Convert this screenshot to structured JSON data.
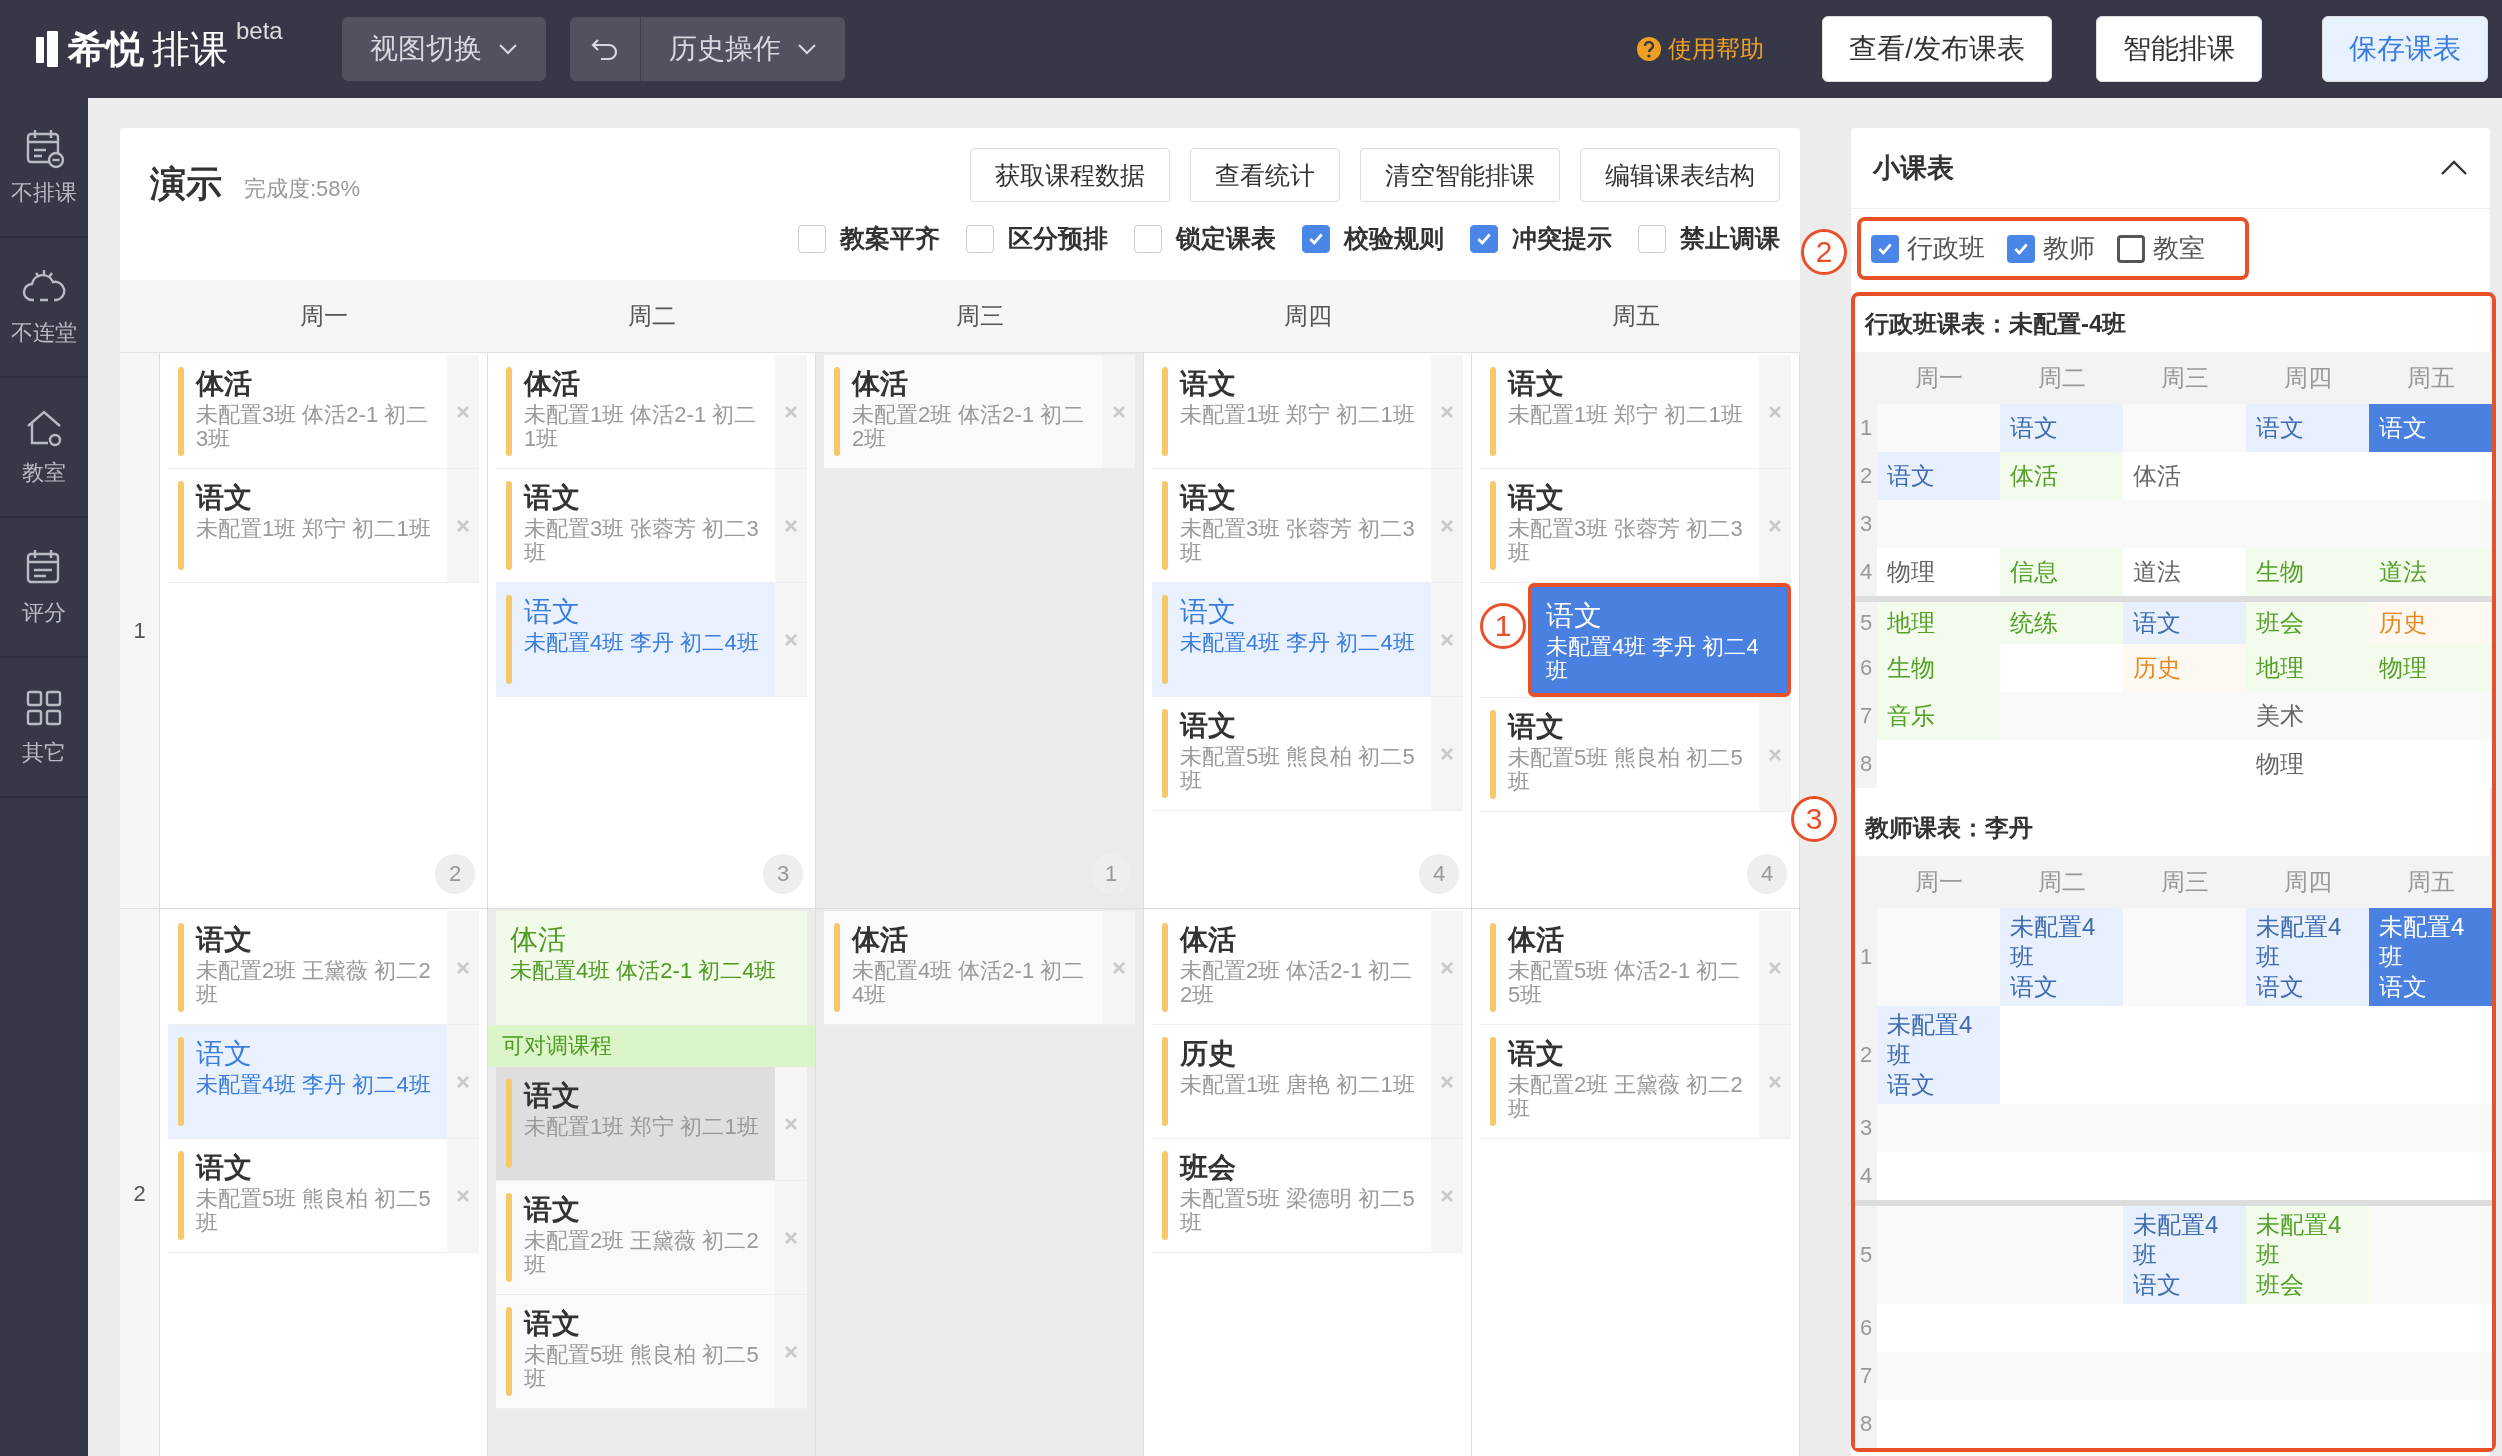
{
  "app": {
    "brand": "希悦",
    "product": "排课",
    "tag": "beta"
  },
  "toolbar": {
    "view_menu": "视图切换",
    "history_menu": "历史操作",
    "help": "使用帮助",
    "buttons": [
      {
        "label": "查看/发布课表",
        "kind": "default"
      },
      {
        "label": "智能排课",
        "kind": "default"
      },
      {
        "label": "保存课表",
        "kind": "primary"
      }
    ]
  },
  "sidebar": [
    {
      "label": "不排课",
      "kind": "calendar"
    },
    {
      "label": "不连堂",
      "kind": "link"
    },
    {
      "label": "教室",
      "kind": "house"
    },
    {
      "label": "评分",
      "kind": "list"
    },
    {
      "label": "其它",
      "kind": "grid"
    }
  ],
  "schedule": {
    "title": "演示",
    "progress": "完成度:58%",
    "actions": [
      "获取课程数据",
      "查看统计",
      "清空智能排课",
      "编辑课表结构"
    ],
    "options": [
      {
        "label": "教案平齐",
        "checked": false
      },
      {
        "label": "区分预排",
        "checked": false
      },
      {
        "label": "锁定课表",
        "checked": false
      },
      {
        "label": "校验规则",
        "checked": true
      },
      {
        "label": "冲突提示",
        "checked": true
      },
      {
        "label": "禁止调课",
        "checked": false
      }
    ],
    "days": [
      "周一",
      "周二",
      "周三",
      "周四",
      "周五"
    ],
    "periods": [
      {
        "label": "1",
        "cells": [
          {
            "shaded": false,
            "count": "2",
            "items": [
              {
                "kind": "normal",
                "selected": false,
                "subject": "体活",
                "info": "未配置3班 体活2-1 初二3班"
              },
              {
                "kind": "normal",
                "selected": false,
                "subject": "语文",
                "info": "未配置1班 郑宁 初二1班"
              }
            ]
          },
          {
            "shaded": false,
            "count": "3",
            "items": [
              {
                "kind": "normal",
                "selected": false,
                "subject": "体活",
                "info": "未配置1班 体活2-1 初二1班"
              },
              {
                "kind": "normal",
                "selected": false,
                "subject": "语文",
                "info": "未配置3班 张蓉芳 初二3班"
              },
              {
                "kind": "related",
                "selected": false,
                "subject": "语文",
                "info": "未配置4班 李丹 初二4班"
              }
            ]
          },
          {
            "shaded": true,
            "count": "1",
            "items": [
              {
                "kind": "normal",
                "selected": false,
                "subject": "体活",
                "info": "未配置2班 体活2-1 初二2班"
              }
            ]
          },
          {
            "shaded": false,
            "count": "4",
            "items": [
              {
                "kind": "normal",
                "selected": false,
                "subject": "语文",
                "info": "未配置1班 郑宁 初二1班"
              },
              {
                "kind": "normal",
                "selected": false,
                "subject": "语文",
                "info": "未配置3班 张蓉芳 初二3班"
              },
              {
                "kind": "related",
                "selected": false,
                "subject": "语文",
                "info": "未配置4班 李丹 初二4班"
              },
              {
                "kind": "normal",
                "selected": false,
                "subject": "语文",
                "info": "未配置5班 熊良柏 初二5班"
              }
            ]
          },
          {
            "shaded": false,
            "count": "4",
            "items": [
              {
                "kind": "normal",
                "selected": false,
                "subject": "语文",
                "info": "未配置1班 郑宁 初二1班"
              },
              {
                "kind": "normal",
                "selected": false,
                "subject": "语文",
                "info": "未配置3班 张蓉芳 初二3班"
              },
              {
                "kind": "related",
                "selected": true,
                "subject": "语文",
                "info": "未配置4班 李丹 初二4班",
                "annotation": "1"
              },
              {
                "kind": "normal",
                "selected": false,
                "subject": "语文",
                "info": "未配置5班 熊良柏 初二5班"
              }
            ]
          }
        ]
      },
      {
        "label": "2",
        "cells": [
          {
            "shaded": false,
            "items": [
              {
                "kind": "normal",
                "selected": false,
                "subject": "语文",
                "info": "未配置2班 王黛薇 初二2班"
              },
              {
                "kind": "related",
                "selected": false,
                "subject": "语文",
                "info": "未配置4班 李丹 初二4班"
              },
              {
                "kind": "normal",
                "selected": false,
                "subject": "语文",
                "info": "未配置5班 熊良柏 初二5班"
              }
            ]
          },
          {
            "shaded": true,
            "items": [
              {
                "kind": "swap",
                "selected": false,
                "subject": "体活",
                "info": "未配置4班 体活2-1 初二4班"
              },
              {
                "kind": "label",
                "text": "可对调课程"
              },
              {
                "kind": "muted",
                "selected": false,
                "subject": "语文",
                "info": "未配置1班 郑宁 初二1班"
              },
              {
                "kind": "normal",
                "selected": false,
                "subject": "语文",
                "info": "未配置2班 王黛薇 初二2班"
              },
              {
                "kind": "normal",
                "selected": false,
                "subject": "语文",
                "info": "未配置5班 熊良柏 初二5班"
              }
            ]
          },
          {
            "shaded": true,
            "items": [
              {
                "kind": "normal",
                "selected": false,
                "subject": "体活",
                "info": "未配置4班 体活2-1 初二4班"
              }
            ]
          },
          {
            "shaded": false,
            "items": [
              {
                "kind": "normal",
                "selected": false,
                "subject": "体活",
                "info": "未配置2班 体活2-1 初二2班"
              },
              {
                "kind": "normal",
                "selected": false,
                "subject": "历史",
                "info": "未配置1班 唐艳 初二1班"
              },
              {
                "kind": "normal",
                "selected": false,
                "subject": "班会",
                "info": "未配置5班 梁德明 初二5班"
              }
            ]
          },
          {
            "shaded": false,
            "items": [
              {
                "kind": "normal",
                "selected": false,
                "subject": "体活",
                "info": "未配置5班 体活2-1 初二5班"
              },
              {
                "kind": "normal",
                "selected": false,
                "subject": "语文",
                "info": "未配置2班 王黛薇 初二2班"
              }
            ]
          }
        ]
      }
    ]
  },
  "mini": {
    "title": "小课表",
    "expanded": true,
    "filters_annotation": "2",
    "tables_annotation": "3",
    "filters": [
      {
        "label": "行政班",
        "checked": true
      },
      {
        "label": "教师",
        "checked": true
      },
      {
        "label": "教室",
        "checked": false
      }
    ],
    "tables": [
      {
        "title": "行政班课表：未配置-4班",
        "days": [
          "周一",
          "周二",
          "周三",
          "周四",
          "周五"
        ],
        "rows": [
          {
            "label": "1",
            "divider_above": false,
            "cells": [
              null,
              {
                "text": "语文",
                "kind": "blue"
              },
              null,
              {
                "text": "语文",
                "kind": "blue"
              },
              {
                "text": "语文",
                "kind": "selected"
              }
            ]
          },
          {
            "label": "2",
            "divider_above": false,
            "cells": [
              {
                "text": "语文",
                "kind": "blue"
              },
              {
                "text": "体活",
                "kind": "green"
              },
              {
                "text": "体活",
                "kind": "plain"
              },
              null,
              null
            ]
          },
          {
            "label": "3",
            "divider_above": false,
            "cells": [
              null,
              null,
              null,
              null,
              null
            ]
          },
          {
            "label": "4",
            "divider_above": false,
            "cells": [
              {
                "text": "物理",
                "kind": "plain"
              },
              {
                "text": "信息",
                "kind": "green"
              },
              {
                "text": "道法",
                "kind": "plain"
              },
              {
                "text": "生物",
                "kind": "green"
              },
              {
                "text": "道法",
                "kind": "green"
              }
            ]
          },
          {
            "label": "5",
            "divider_above": true,
            "cells": [
              {
                "text": "地理",
                "kind": "green"
              },
              {
                "text": "统练",
                "kind": "green"
              },
              {
                "text": "语文",
                "kind": "blue"
              },
              {
                "text": "班会",
                "kind": "green"
              },
              {
                "text": "历史",
                "kind": "orange"
              }
            ]
          },
          {
            "label": "6",
            "divider_above": false,
            "cells": [
              {
                "text": "生物",
                "kind": "green"
              },
              null,
              {
                "text": "历史",
                "kind": "orange"
              },
              {
                "text": "地理",
                "kind": "green"
              },
              {
                "text": "物理",
                "kind": "green"
              }
            ]
          },
          {
            "label": "7",
            "divider_above": false,
            "cells": [
              {
                "text": "音乐",
                "kind": "green"
              },
              null,
              null,
              {
                "text": "美术",
                "kind": "plain"
              },
              null
            ]
          },
          {
            "label": "8",
            "divider_above": false,
            "cells": [
              null,
              null,
              null,
              {
                "text": "物理",
                "kind": "plain"
              },
              null
            ]
          }
        ]
      },
      {
        "title": "教师课表：李丹",
        "days": [
          "周一",
          "周二",
          "周三",
          "周四",
          "周五"
        ],
        "rows": [
          {
            "label": "1",
            "divider_above": false,
            "cells": [
              null,
              {
                "class": "未配置4班",
                "text": "语文",
                "kind": "blue"
              },
              null,
              {
                "class": "未配置4班",
                "text": "语文",
                "kind": "blue"
              },
              {
                "class": "未配置4班",
                "text": "语文",
                "kind": "selected"
              }
            ]
          },
          {
            "label": "2",
            "divider_above": false,
            "cells": [
              {
                "class": "未配置4班",
                "text": "语文",
                "kind": "blue"
              },
              null,
              null,
              null,
              null
            ]
          },
          {
            "label": "3",
            "divider_above": false,
            "cells": [
              null,
              null,
              null,
              null,
              null
            ]
          },
          {
            "label": "4",
            "divider_above": false,
            "cells": [
              null,
              null,
              null,
              null,
              null
            ]
          },
          {
            "label": "5",
            "divider_above": true,
            "cells": [
              null,
              null,
              {
                "class": "未配置4班",
                "text": "语文",
                "kind": "blue"
              },
              {
                "class": "未配置4班",
                "text": "班会",
                "kind": "green"
              },
              null
            ]
          },
          {
            "label": "6",
            "divider_above": false,
            "cells": [
              null,
              null,
              null,
              null,
              null
            ]
          },
          {
            "label": "7",
            "divider_above": false,
            "cells": [
              null,
              null,
              null,
              null,
              null
            ]
          },
          {
            "label": "8",
            "divider_above": false,
            "cells": [
              null,
              null,
              null,
              null,
              null
            ]
          }
        ]
      }
    ]
  }
}
